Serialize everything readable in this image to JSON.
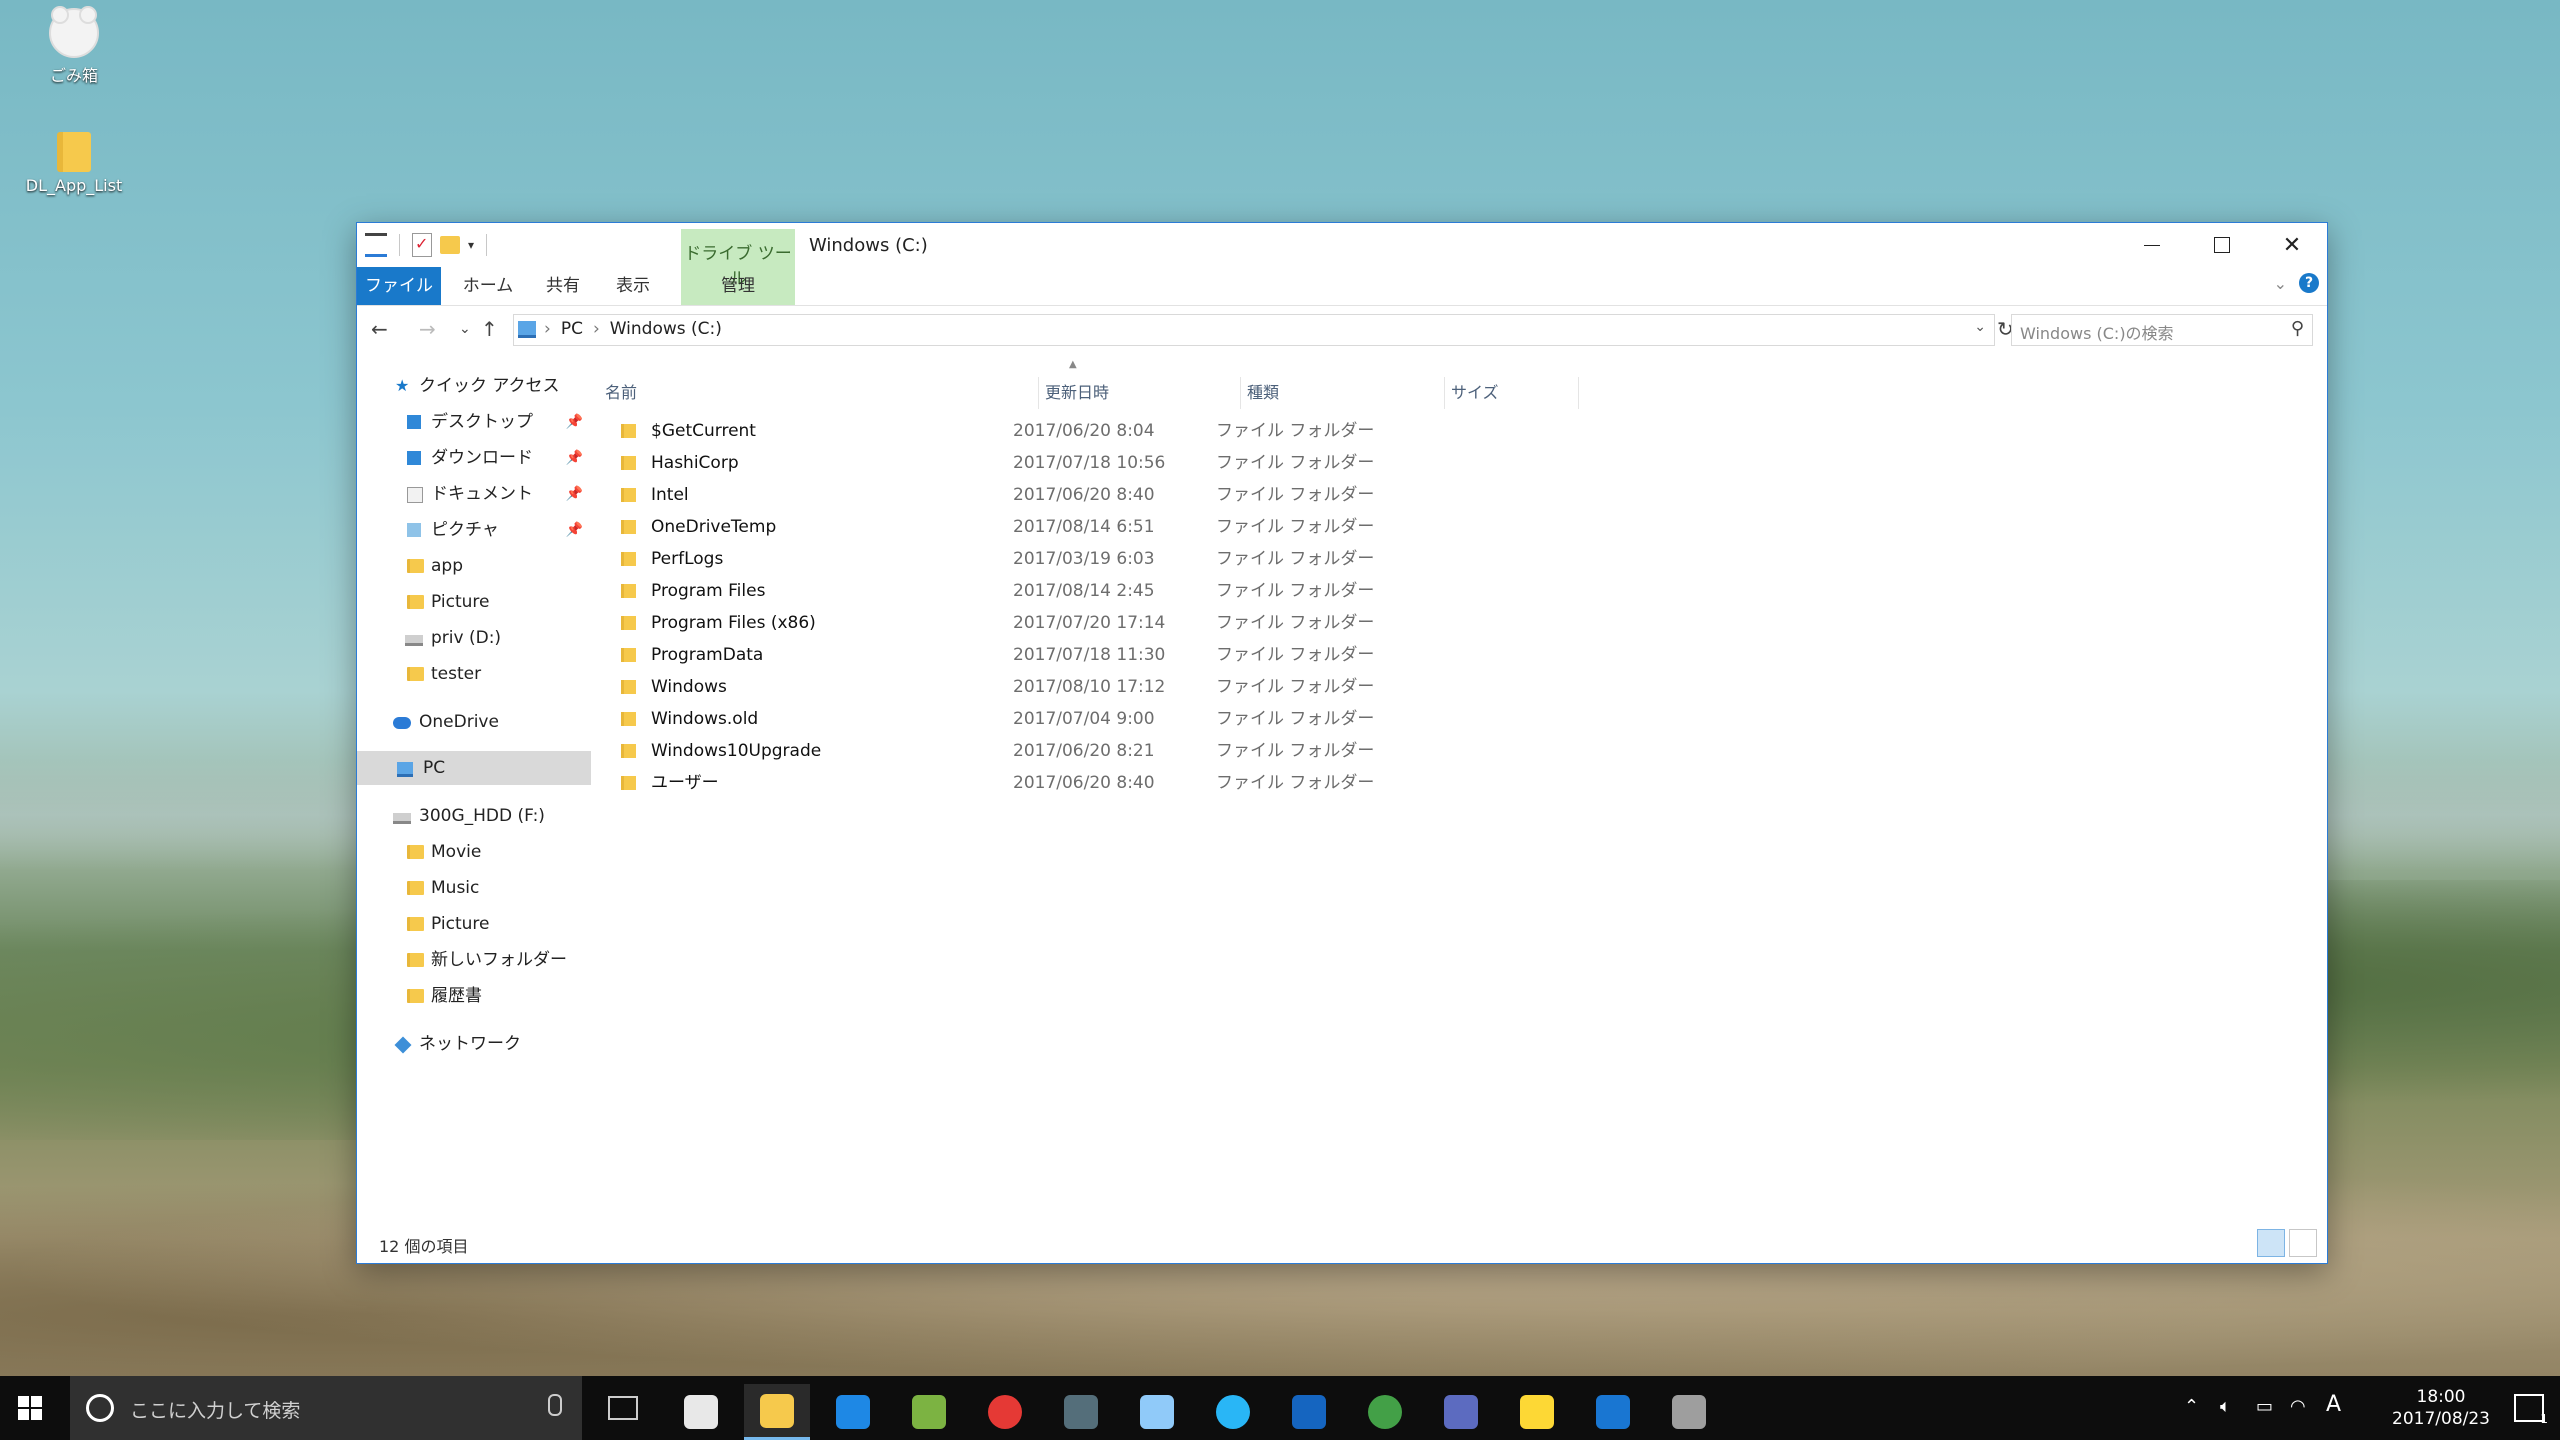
{
  "desktop": {
    "icons": [
      {
        "label": "ごみ箱",
        "icon": "recycle-bin-icon"
      },
      {
        "label": "DL_App_List",
        "icon": "folder-icon"
      }
    ]
  },
  "window": {
    "context_tab_group": "ドライブ ツール",
    "title": "Windows (C:)",
    "ribbon_tabs": {
      "file": "ファイル",
      "home": "ホーム",
      "share": "共有",
      "view": "表示",
      "manage": "管理"
    },
    "address": {
      "crumbs": [
        "PC",
        "Windows (C:)"
      ],
      "separator": "›"
    },
    "search_placeholder": "Windows (C:)の検索",
    "columns": {
      "name": "名前",
      "date": "更新日時",
      "type": "種類",
      "size": "サイズ"
    },
    "files": [
      {
        "name": "$GetCurrent",
        "date": "2017/06/20 8:04",
        "type": "ファイル フォルダー"
      },
      {
        "name": "HashiCorp",
        "date": "2017/07/18 10:56",
        "type": "ファイル フォルダー"
      },
      {
        "name": "Intel",
        "date": "2017/06/20 8:40",
        "type": "ファイル フォルダー"
      },
      {
        "name": "OneDriveTemp",
        "date": "2017/08/14 6:51",
        "type": "ファイル フォルダー"
      },
      {
        "name": "PerfLogs",
        "date": "2017/03/19 6:03",
        "type": "ファイル フォルダー"
      },
      {
        "name": "Program Files",
        "date": "2017/08/14 2:45",
        "type": "ファイル フォルダー"
      },
      {
        "name": "Program Files (x86)",
        "date": "2017/07/20 17:14",
        "type": "ファイル フォルダー"
      },
      {
        "name": "ProgramData",
        "date": "2017/07/18 11:30",
        "type": "ファイル フォルダー"
      },
      {
        "name": "Windows",
        "date": "2017/08/10 17:12",
        "type": "ファイル フォルダー"
      },
      {
        "name": "Windows.old",
        "date": "2017/07/04 9:00",
        "type": "ファイル フォルダー"
      },
      {
        "name": "Windows10Upgrade",
        "date": "2017/06/20 8:21",
        "type": "ファイル フォルダー"
      },
      {
        "name": "ユーザー",
        "date": "2017/06/20 8:40",
        "type": "ファイル フォルダー"
      }
    ],
    "status_count": "12 個の項目",
    "nav": {
      "quick_access": "クイック アクセス",
      "quick_items": [
        "デスクトップ",
        "ダウンロード",
        "ドキュメント",
        "ピクチャ",
        "app",
        "Picture",
        "priv (D:)",
        "tester"
      ],
      "onedrive": "OneDrive",
      "pc": "PC",
      "hdd": "300G_HDD (F:)",
      "hdd_items": [
        "Movie",
        "Music",
        "Picture",
        "新しいフォルダー",
        "履歴書"
      ],
      "network": "ネットワーク"
    }
  },
  "taskbar": {
    "search_placeholder": "ここに入力して検索",
    "apps": [
      "mail-icon",
      "file-explorer-icon",
      "edge-icon",
      "android-studio-icon",
      "chrome-icon",
      "remote-desktop-icon",
      "notepad-icon",
      "globe-icon",
      "powershell-icon",
      "atom-icon",
      "network-tool-icon",
      "duck-icon",
      "window-app-icon",
      "database-icon"
    ],
    "ime": "A",
    "time": "18:00",
    "date": "2017/08/23",
    "notification_count": "1"
  }
}
